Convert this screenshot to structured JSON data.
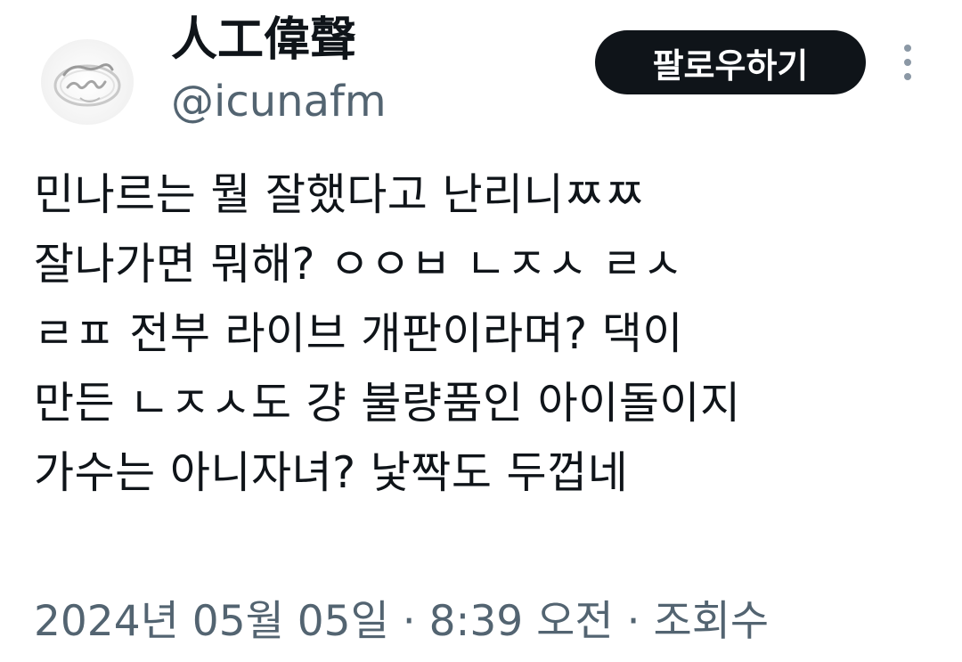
{
  "profile": {
    "display_name": "人工偉聲",
    "handle": "@icunafm",
    "avatar_icon": "ring-avatar"
  },
  "header": {
    "follow_label": "팔로우하기",
    "more_icon": "more-vertical-icon"
  },
  "tweet": {
    "lines": [
      "민나르는 뭘 잘했다고 난리니ㅉㅉ",
      "잘나가면 뭐해? ㅇㅇㅂ  ㄴㅈㅅ  ㄹㅅ",
      "ㄹㅍ 전부 라이브 개판이라며? 댁이",
      "만든 ㄴㅈㅅ도 걍 불량품인 아이돌이지",
      "가수는 아니자녀? 낯짝도 두껍네"
    ]
  },
  "meta": {
    "date": "2024년 05월 05일",
    "separator": " · ",
    "time": "8:39 오전",
    "views_label": "조회수"
  },
  "colors": {
    "text": "#0f1419",
    "secondary": "#536471",
    "button_bg": "#0f1419",
    "button_text": "#ffffff"
  }
}
